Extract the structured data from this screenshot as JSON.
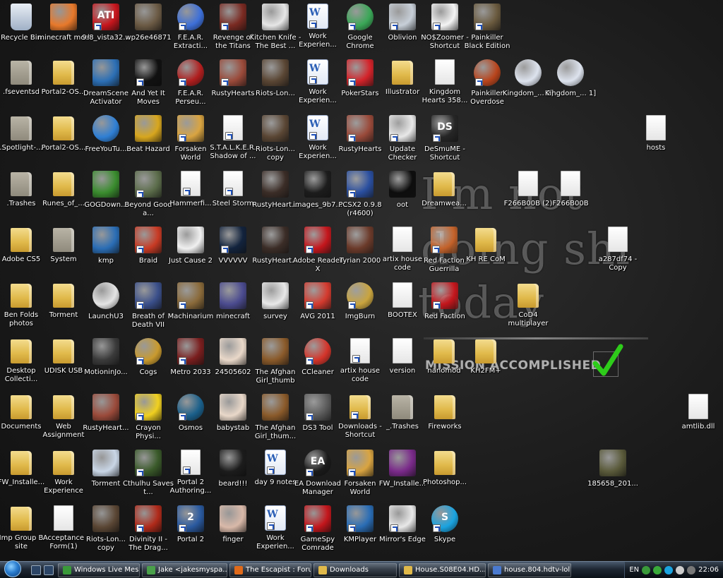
{
  "desktop": {
    "wallpaper": {
      "line1": "I'm not",
      "line2": "doing shi",
      "line3": "today",
      "mission": "MISSION ACCOMPLISHED"
    },
    "icons": [
      {
        "label": "Recycle Bin",
        "type": "bin",
        "color": "#c9d6e6",
        "shortcut": false
      },
      {
        "label": "minecraft mod",
        "type": "app",
        "color": "#e8792b",
        "shortcut": false
      },
      {
        "label": "9-8_vista32...",
        "type": "app",
        "color": "#c8161d",
        "glyph": "ATI",
        "shortcut": true
      },
      {
        "label": "wp26e46871",
        "type": "app",
        "color": "#6b5a44",
        "shortcut": false
      },
      {
        "label": "F.E.A.R. Extracti...",
        "type": "round",
        "color": "#3d6fd8",
        "shortcut": true
      },
      {
        "label": "Revenge of the Titans",
        "type": "app",
        "color": "#7a2a22",
        "shortcut": true
      },
      {
        "label": "Kitchen Knife - The Best ...",
        "type": "app",
        "color": "#e6e6e6",
        "shortcut": false
      },
      {
        "label": "Work Experien...",
        "type": "word",
        "shortcut": true
      },
      {
        "label": "Google Chrome",
        "type": "round",
        "color": "#3aa757",
        "shortcut": true
      },
      {
        "label": "Oblivion",
        "type": "app",
        "color": "#c7cfd8",
        "shortcut": true
      },
      {
        "label": "NO$Zoomer - Shortcut",
        "type": "app",
        "color": "#f4f4f4",
        "shortcut": true
      },
      {
        "label": "Painkiller Black Edition",
        "type": "app",
        "color": "#6a5a3e",
        "shortcut": true
      },
      {
        "label": ".fseventsd",
        "type": "foldergray",
        "shortcut": false
      },
      {
        "label": "Portal2-OS...",
        "type": "folder",
        "shortcut": false
      },
      {
        "label": "DreamScene Activator",
        "type": "app",
        "color": "#2c6fb5",
        "shortcut": false
      },
      {
        "label": "And Yet It Moves",
        "type": "app",
        "color": "#111111",
        "shortcut": true
      },
      {
        "label": "F.E.A.R. Perseu...",
        "type": "round",
        "color": "#b01e1e",
        "shortcut": true
      },
      {
        "label": "RustyHearts",
        "type": "app",
        "color": "#9a4a3a",
        "shortcut": true
      },
      {
        "label": "Riots-Lon...",
        "type": "app",
        "color": "#5a4634",
        "shortcut": false
      },
      {
        "label": "Work Experien...",
        "type": "word",
        "shortcut": true
      },
      {
        "label": "PokerStars",
        "type": "app",
        "color": "#d4232a",
        "shortcut": true
      },
      {
        "label": "Illustrator",
        "type": "folder",
        "shortcut": false
      },
      {
        "label": "Kingdom Hearts 358...",
        "type": "doc",
        "shortcut": false
      },
      {
        "label": "Painkiller Overdose",
        "type": "round",
        "color": "#b8441c",
        "shortcut": true
      },
      {
        "label": "Kingdom_... 2]",
        "type": "round",
        "color": "#dde3ee",
        "shortcut": false
      },
      {
        "label": "Kingdom_... 1]",
        "type": "round",
        "color": "#dde3ee",
        "shortcut": false
      },
      {
        "label": ".Spotlight-...",
        "type": "foldergray",
        "shortcut": false
      },
      {
        "label": "Portal2-OS...",
        "type": "folder",
        "shortcut": false
      },
      {
        "label": "FreeYouTu...",
        "type": "round",
        "color": "#2f7fd4",
        "shortcut": false
      },
      {
        "label": "Beat Hazard",
        "type": "app",
        "color": "#d7a61e",
        "shortcut": false
      },
      {
        "label": "Forsaken World",
        "type": "app",
        "color": "#d9a441",
        "shortcut": true
      },
      {
        "label": "S.T.A.L.K.E.R. Shadow of ...",
        "type": "doc",
        "shortcut": true
      },
      {
        "label": "Riots-Lon... copy",
        "type": "app",
        "color": "#5a4634",
        "shortcut": false
      },
      {
        "label": "Work Experien...",
        "type": "word",
        "shortcut": true
      },
      {
        "label": "RustyHearts",
        "type": "app",
        "color": "#9a4a3a",
        "shortcut": true
      },
      {
        "label": "Update Checker",
        "type": "app",
        "color": "#e8e8e8",
        "shortcut": true
      },
      {
        "label": "DeSmuME - Shortcut",
        "type": "app",
        "color": "#262626",
        "glyph": "DS",
        "shortcut": true
      },
      {
        "label": "hosts",
        "type": "doc",
        "shortcut": false
      },
      {
        "label": ".Trashes",
        "type": "foldergray",
        "shortcut": false
      },
      {
        "label": "Runes_of_...",
        "type": "folder",
        "shortcut": false
      },
      {
        "label": "GOGDown...",
        "type": "app",
        "color": "#3a8c2e",
        "shortcut": false
      },
      {
        "label": "Beyond Good a...",
        "type": "app",
        "color": "#5b6c4a",
        "shortcut": true
      },
      {
        "label": "Hammerfi...",
        "type": "doc",
        "shortcut": true
      },
      {
        "label": "Steel Storm",
        "type": "doc",
        "shortcut": true
      },
      {
        "label": "RustyHeart...",
        "type": "app",
        "color": "#3b2d27",
        "shortcut": false
      },
      {
        "label": "images_9b7...",
        "type": "app",
        "color": "#1c1c1c",
        "shortcut": false
      },
      {
        "label": "PCSX2 0.9.8 (r4600)",
        "type": "app",
        "color": "#2a4fa0",
        "shortcut": true
      },
      {
        "label": "oot",
        "type": "app",
        "color": "#0d0d0d",
        "shortcut": false
      },
      {
        "label": "Dreamwea...",
        "type": "folder",
        "shortcut": false
      },
      {
        "label": "F266B00B (2)",
        "type": "doc",
        "shortcut": false
      },
      {
        "label": "F266B00B",
        "type": "doc",
        "shortcut": false
      },
      {
        "label": "Adobe CS5",
        "type": "folder",
        "shortcut": false
      },
      {
        "label": "System",
        "type": "foldergray",
        "shortcut": false
      },
      {
        "label": "kmp",
        "type": "app",
        "color": "#2a6db5",
        "shortcut": false
      },
      {
        "label": "Braid",
        "type": "app",
        "color": "#c83a24",
        "shortcut": true
      },
      {
        "label": "Just Cause 2",
        "type": "app",
        "color": "#f0f0f0",
        "shortcut": false
      },
      {
        "label": "VVVVVV",
        "type": "app",
        "color": "#12233d",
        "shortcut": true
      },
      {
        "label": "RustyHeart...",
        "type": "app",
        "color": "#3b2d27",
        "shortcut": false
      },
      {
        "label": "Adobe Reader X",
        "type": "app",
        "color": "#c4161c",
        "shortcut": true
      },
      {
        "label": "Tyrian 2000",
        "type": "app",
        "color": "#6b3a2a",
        "shortcut": false
      },
      {
        "label": "artix house code",
        "type": "doc",
        "shortcut": false
      },
      {
        "label": "Red Faction Guerrilla",
        "type": "app",
        "color": "#c4622a",
        "shortcut": true
      },
      {
        "label": "KH RE CoM",
        "type": "folder",
        "shortcut": false
      },
      {
        "label": "a287df74 - Copy",
        "type": "doc",
        "shortcut": false
      },
      {
        "label": "Ben Folds photos",
        "type": "folder",
        "shortcut": false
      },
      {
        "label": "Torment",
        "type": "folder",
        "shortcut": false
      },
      {
        "label": "LaunchU3",
        "type": "round",
        "color": "#e4e4e4",
        "shortcut": false
      },
      {
        "label": "Breath of Death VII",
        "type": "app",
        "color": "#3a4f8a",
        "shortcut": true
      },
      {
        "label": "Machinarium",
        "type": "app",
        "color": "#8a6a3a",
        "shortcut": true
      },
      {
        "label": "minecraft",
        "type": "app",
        "color": "#4b4b8f",
        "shortcut": false
      },
      {
        "label": "survey",
        "type": "app",
        "color": "#e8e8e8",
        "shortcut": false
      },
      {
        "label": "AVG 2011",
        "type": "app",
        "color": "#d43a2e",
        "shortcut": true
      },
      {
        "label": "ImgBurn",
        "type": "round",
        "color": "#c9a43e",
        "shortcut": true
      },
      {
        "label": "BOOTEX",
        "type": "doc",
        "shortcut": false
      },
      {
        "label": "Red Faction",
        "type": "app",
        "color": "#c4161c",
        "shortcut": true
      },
      {
        "label": "CoD4 multiplayer",
        "type": "folder",
        "shortcut": false
      },
      {
        "label": "Desktop Collecti...",
        "type": "folder",
        "shortcut": false
      },
      {
        "label": "UDISK USB",
        "type": "folder",
        "shortcut": false
      },
      {
        "label": "MotioninJo...",
        "type": "app",
        "color": "#3a3a3a",
        "shortcut": false
      },
      {
        "label": "Cogs",
        "type": "round",
        "color": "#c99a2e",
        "shortcut": true
      },
      {
        "label": "Metro 2033",
        "type": "app",
        "color": "#7a1e1e",
        "shortcut": true
      },
      {
        "label": "24505602",
        "type": "app",
        "color": "#e9d8c9",
        "shortcut": false
      },
      {
        "label": "The Afghan Girl_thumb",
        "type": "app",
        "color": "#8a5a2a",
        "shortcut": false
      },
      {
        "label": "CCleaner",
        "type": "round",
        "color": "#d4342a",
        "shortcut": true
      },
      {
        "label": "artix house code",
        "type": "doc",
        "shortcut": true
      },
      {
        "label": "version",
        "type": "doc",
        "shortcut": false
      },
      {
        "label": "nanomod",
        "type": "folder",
        "shortcut": false
      },
      {
        "label": "KH2FM+",
        "type": "folder",
        "shortcut": false
      },
      {
        "label": "Documents",
        "type": "folder",
        "shortcut": false
      },
      {
        "label": "Web Assignment",
        "type": "folder",
        "shortcut": false
      },
      {
        "label": "RustyHeart...",
        "type": "app",
        "color": "#9a4a3a",
        "shortcut": false
      },
      {
        "label": "Crayon Physi...",
        "type": "app",
        "color": "#f0d020",
        "shortcut": true
      },
      {
        "label": "Osmos",
        "type": "round",
        "color": "#1a5f8a",
        "shortcut": true
      },
      {
        "label": "babystab",
        "type": "app",
        "color": "#e9d8c9",
        "shortcut": false
      },
      {
        "label": "The Afghan Girl_thum...",
        "type": "app",
        "color": "#8a5a2a",
        "shortcut": false
      },
      {
        "label": "DS3 Tool",
        "type": "app",
        "color": "#5a5a5a",
        "shortcut": true
      },
      {
        "label": "Downloads - Shortcut",
        "type": "folder",
        "shortcut": true
      },
      {
        "label": "_.Trashes",
        "type": "foldergray",
        "shortcut": false
      },
      {
        "label": "Fireworks",
        "type": "folder",
        "shortcut": false
      },
      {
        "label": "amtlib.dll",
        "type": "doc",
        "shortcut": false
      },
      {
        "label": "FW_Installe...",
        "type": "folder",
        "shortcut": false
      },
      {
        "label": "Work Experience",
        "type": "folder",
        "shortcut": false
      },
      {
        "label": "Torment",
        "type": "app",
        "color": "#c9d6e6",
        "shortcut": false
      },
      {
        "label": "Cthulhu Saves t...",
        "type": "app",
        "color": "#3a5a2a",
        "shortcut": true
      },
      {
        "label": "Portal 2 Authoring...",
        "type": "doc",
        "shortcut": true
      },
      {
        "label": "beard!!!",
        "type": "app",
        "color": "#1c1c1c",
        "shortcut": false
      },
      {
        "label": "day 9 notes",
        "type": "word",
        "shortcut": true
      },
      {
        "label": "EA Download Manager",
        "type": "round",
        "color": "#1a1a1a",
        "glyph": "EA",
        "shortcut": true
      },
      {
        "label": "Forsaken World",
        "type": "app",
        "color": "#d9a441",
        "shortcut": true
      },
      {
        "label": "FW_Installe...",
        "type": "app",
        "color": "#7a2a8a",
        "shortcut": false
      },
      {
        "label": "Photoshop...",
        "type": "folder",
        "shortcut": false
      },
      {
        "label": "185658_201...",
        "type": "app",
        "color": "#5a5a3a",
        "shortcut": false
      },
      {
        "label": "Imp Group B site",
        "type": "folder",
        "shortcut": false
      },
      {
        "label": "Acceptance Form(1)",
        "type": "doc",
        "shortcut": false
      },
      {
        "label": "Riots-Lon... copy",
        "type": "app",
        "color": "#5a4634",
        "shortcut": false
      },
      {
        "label": "Divinity II - The Drag...",
        "type": "app",
        "color": "#b02a1a",
        "shortcut": true
      },
      {
        "label": "Portal 2",
        "type": "app",
        "color": "#2a5aa0",
        "glyph": "2",
        "shortcut": true
      },
      {
        "label": "finger",
        "type": "app",
        "color": "#d9b9a9",
        "shortcut": false
      },
      {
        "label": "Work Experien...",
        "type": "word",
        "shortcut": true
      },
      {
        "label": "GameSpy Comrade",
        "type": "app",
        "color": "#c4161c",
        "shortcut": true
      },
      {
        "label": "KMPlayer",
        "type": "app",
        "color": "#2a6db5",
        "shortcut": true
      },
      {
        "label": "Mirror's Edge",
        "type": "app",
        "color": "#e8e8e8",
        "shortcut": true
      },
      {
        "label": "Skype",
        "type": "round",
        "color": "#1aa3e0",
        "glyph": "S",
        "shortcut": true
      }
    ]
  },
  "taskbar": {
    "tasks": [
      {
        "label": "Windows Live Mes...",
        "color": "#3a9a3a"
      },
      {
        "label": "Jake <jakesmyspa...",
        "color": "#4aa04a"
      },
      {
        "label": "The Escapist : Foru...",
        "color": "#e06a1a"
      },
      {
        "label": "Downloads",
        "color": "#e0b94a"
      },
      {
        "label": "House.S08E04.HD...",
        "color": "#e0b94a"
      },
      {
        "label": "house.804.hdtv-lol...",
        "color": "#4a7ad0"
      }
    ],
    "tray": {
      "language": "EN",
      "time": "22:06"
    }
  }
}
